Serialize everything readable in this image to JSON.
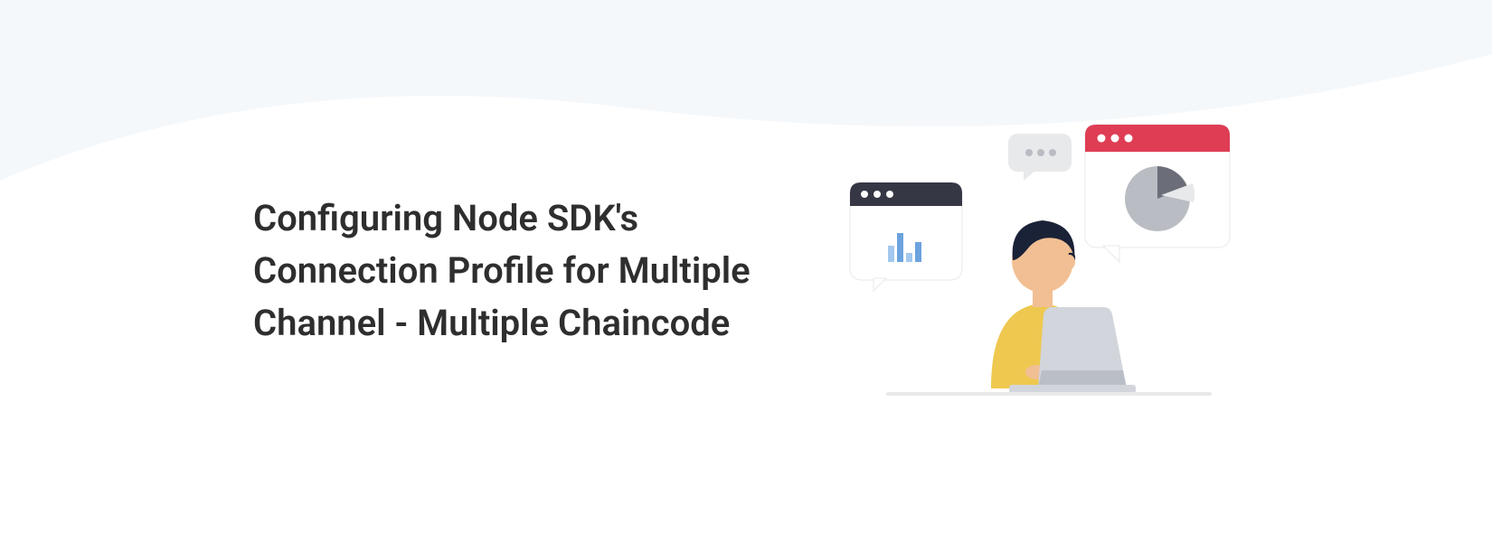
{
  "heading": "Configuring Node SDK's Connection Profile for Multiple Channel - Multiple Chaincode",
  "colors": {
    "bg_wave": "#f5f8fb",
    "text": "#2e2e2e",
    "red": "#de3d54",
    "dark": "#353744",
    "light_grey": "#e8e9eb",
    "mid_grey": "#b9bcc2",
    "darker_grey": "#6b6e78",
    "light_blue": "#a3c8ee",
    "mid_blue": "#6ba3de",
    "skin": "#f1bf93",
    "yellow": "#eec84f",
    "hair": "#1a2237",
    "laptop": "#d2d5db",
    "laptop_dark": "#babec7"
  },
  "illustration": {
    "elements": [
      "speech-bubble-dots",
      "window-bar-chart",
      "window-pie-chart",
      "person",
      "laptop"
    ]
  }
}
